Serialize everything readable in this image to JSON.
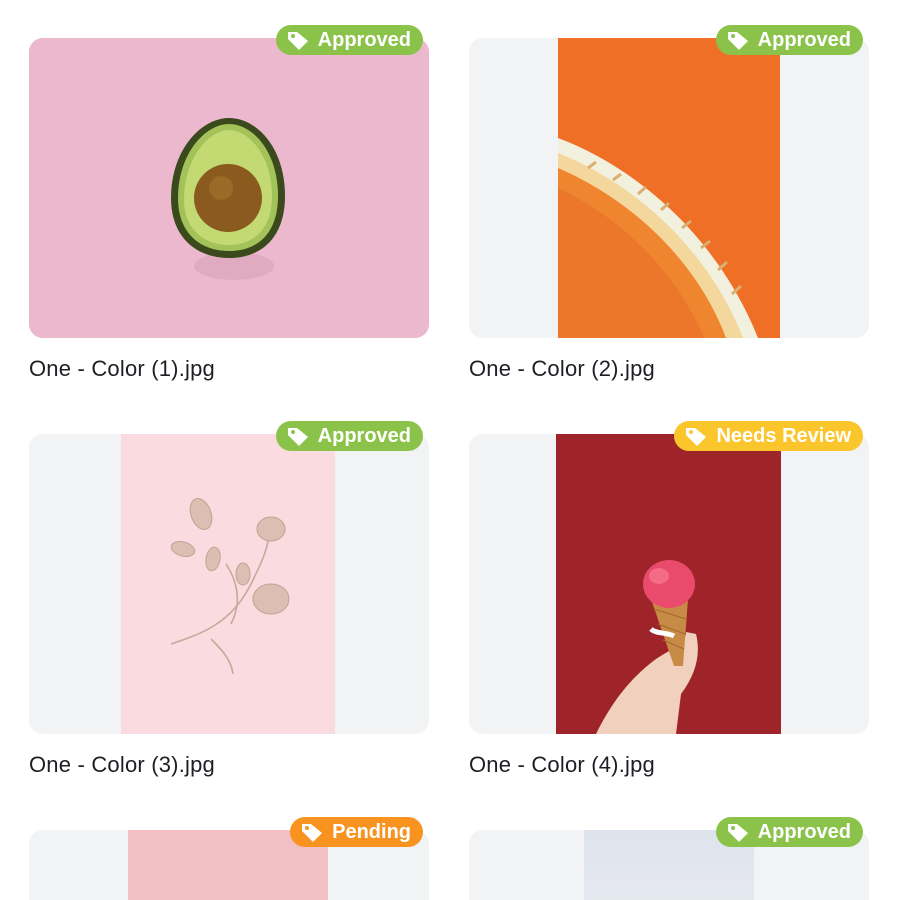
{
  "cards": [
    {
      "file_name": "One - Color (1).jpg",
      "status": "Approved",
      "status_color": "#8bc34a",
      "image": "avocado-on-pink",
      "background": "#ecb8cd"
    },
    {
      "file_name": "One - Color (2).jpg",
      "status": "Approved",
      "status_color": "#8bc34a",
      "image": "orange-spiral-staircase",
      "background": "#f2f3f5"
    },
    {
      "file_name": "One - Color (3).jpg",
      "status": "Approved",
      "status_color": "#8bc34a",
      "image": "dried-flower-on-pink",
      "background": "#f2f3f5"
    },
    {
      "file_name": "One - Color (4).jpg",
      "status": "Needs Review",
      "status_color": "#fbc62c",
      "image": "ice-cream-on-red",
      "background": "#f2f3f5"
    },
    {
      "status": "Pending",
      "status_color": "#f7931e",
      "image": "pink-photo",
      "background": "#f2f3f5"
    },
    {
      "status": "Approved",
      "status_color": "#8bc34a",
      "image": "pale-blue-photo",
      "background": "#f2f3f5"
    }
  ]
}
